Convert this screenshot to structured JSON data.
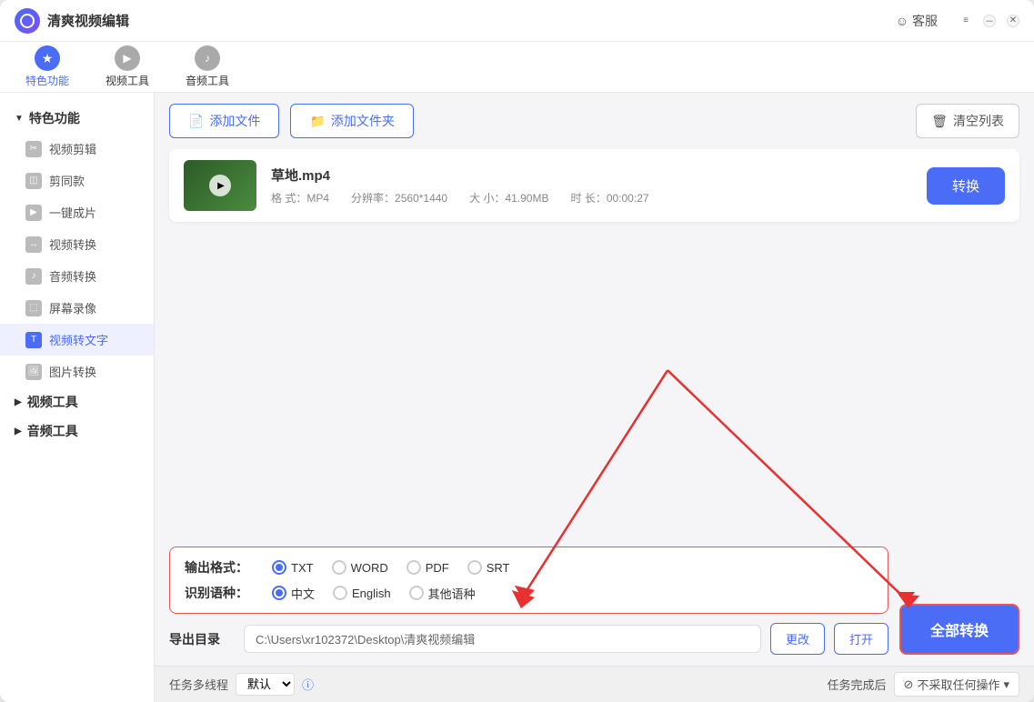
{
  "app": {
    "title": "清爽视频编辑",
    "customer_service": "客服"
  },
  "toolbar": {
    "items": [
      {
        "id": "features",
        "label": "特色功能",
        "active": true
      },
      {
        "id": "video-tools",
        "label": "视频工具",
        "active": false
      },
      {
        "id": "audio-tools",
        "label": "音频工具",
        "active": false
      }
    ]
  },
  "action_bar": {
    "add_file": "添加文件",
    "add_folder": "添加文件夹",
    "clear_list": "清空列表"
  },
  "sidebar": {
    "section1": {
      "label": "特色功能",
      "expanded": true,
      "items": [
        {
          "id": "video-edit",
          "label": "视频剪辑",
          "active": false
        },
        {
          "id": "clip-same",
          "label": "剪同款",
          "active": false
        },
        {
          "id": "one-click",
          "label": "一键成片",
          "active": false
        },
        {
          "id": "video-convert",
          "label": "视频转换",
          "active": false
        },
        {
          "id": "audio-convert",
          "label": "音频转换",
          "active": false
        },
        {
          "id": "screen-record",
          "label": "屏幕录像",
          "active": false
        },
        {
          "id": "video-to-text",
          "label": "视频转文字",
          "active": true
        },
        {
          "id": "image-convert",
          "label": "图片转换",
          "active": false
        }
      ]
    },
    "section2": {
      "label": "视频工具",
      "expanded": false
    },
    "section3": {
      "label": "音频工具",
      "expanded": false
    }
  },
  "file": {
    "name": "草地.mp4",
    "format": "MP4",
    "resolution": "2560*1440",
    "size": "41.90MB",
    "duration": "00:00:27",
    "format_label": "格 式：",
    "resolution_label": "分辨率：",
    "size_label": "大 小：",
    "duration_label": "时 长："
  },
  "convert_btn": "转换",
  "convert_all_btn": "全部转换",
  "output_format": {
    "label": "输出格式：",
    "options": [
      {
        "id": "txt",
        "label": "TXT",
        "selected": true
      },
      {
        "id": "word",
        "label": "WORD",
        "selected": false
      },
      {
        "id": "pdf",
        "label": "PDF",
        "selected": false
      },
      {
        "id": "srt",
        "label": "SRT",
        "selected": false
      }
    ]
  },
  "recognition_language": {
    "label": "识别语种：",
    "options": [
      {
        "id": "chinese",
        "label": "中文",
        "selected": true
      },
      {
        "id": "english",
        "label": "English",
        "selected": false
      },
      {
        "id": "other",
        "label": "其他语种",
        "selected": false
      }
    ]
  },
  "output_dir": {
    "label": "导出目录",
    "path": "C:\\Users\\xr102372\\Desktop\\清爽视频编辑",
    "change_btn": "更改",
    "open_btn": "打开"
  },
  "status_bar": {
    "task_label": "任务多线程",
    "task_value": "默认",
    "info_label": "任务完成后",
    "action_label": "不采取任何操作"
  }
}
